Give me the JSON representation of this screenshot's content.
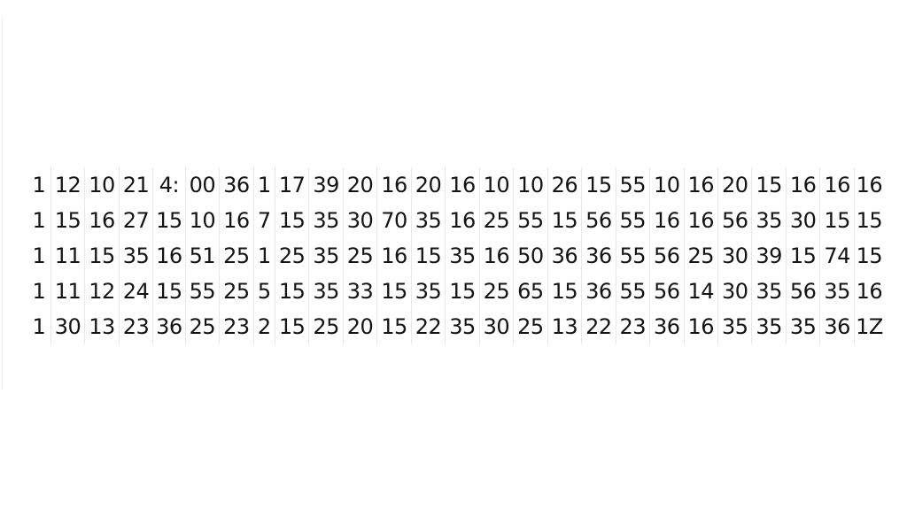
{
  "table": {
    "rows": [
      [
        "1",
        "12",
        "10",
        "21",
        "4:",
        "00",
        "36",
        "1",
        "17",
        "39",
        "20",
        "16",
        "20",
        "16",
        "10",
        "10",
        "26",
        "15",
        "55",
        "10",
        "16",
        "20",
        "15",
        "16",
        "16",
        "16"
      ],
      [
        "1",
        "15",
        "16",
        "27",
        "15",
        "10",
        "16",
        "7",
        "15",
        "35",
        "30",
        "70",
        "35",
        "16",
        "25",
        "55",
        "15",
        "56",
        "55",
        "16",
        "16",
        "56",
        "35",
        "30",
        "15",
        "15"
      ],
      [
        "1",
        "11",
        "15",
        "35",
        "16",
        "51",
        "25",
        "1",
        "25",
        "35",
        "25",
        "16",
        "15",
        "35",
        "16",
        "50",
        "36",
        "36",
        "55",
        "56",
        "25",
        "30",
        "39",
        "15",
        "74",
        "15"
      ],
      [
        "1",
        "11",
        "12",
        "24",
        "15",
        "55",
        "25",
        "5",
        "15",
        "35",
        "33",
        "15",
        "35",
        "15",
        "25",
        "65",
        "15",
        "36",
        "55",
        "56",
        "14",
        "30",
        "35",
        "56",
        "35",
        "16"
      ],
      [
        "1",
        "30",
        "13",
        "23",
        "36",
        "25",
        "23",
        "2",
        "15",
        "25",
        "20",
        "15",
        "22",
        "35",
        "30",
        "25",
        "13",
        "22",
        "23",
        "36",
        "16",
        "35",
        "35",
        "35",
        "36",
        "1Z"
      ]
    ]
  }
}
